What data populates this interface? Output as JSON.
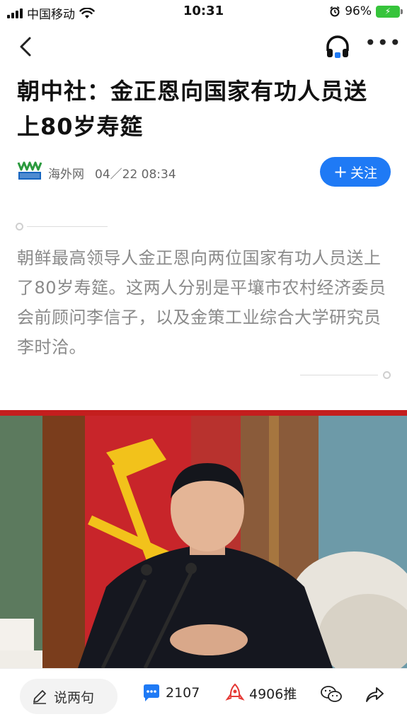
{
  "status_bar": {
    "carrier": "中国移动",
    "time": "10:31",
    "battery": "96%"
  },
  "icons": {
    "back": "back-arrow-icon",
    "listen": "headphones-icon",
    "more": "more-dots-icon",
    "follow_plus": "plus-icon",
    "comment": "pencil-icon",
    "comments_count": "chat-bubble-icon",
    "recommend": "rocket-icon",
    "wechat": "wechat-icon",
    "share": "share-arrow-icon"
  },
  "article": {
    "title": "朝中社：金正恩向国家有功人员送上80岁寿筵",
    "source": "海外网",
    "publish_time": "04／22 08:34",
    "follow_label": "关注",
    "summary": "朝鲜最高领导人金正恩向两位国家有功人员送上了80岁寿筵。这两人分别是平壤市农村经济委员会前顾问李信子，以及金策工业综合大学研究员李时洽。"
  },
  "bottom_bar": {
    "comment_placeholder": "说两句",
    "comment_count": "2107",
    "recommend_label": "4906推"
  },
  "colors": {
    "accent": "#1f7af5",
    "photo_banner": "#c41e1e",
    "battery": "#36c43b"
  }
}
